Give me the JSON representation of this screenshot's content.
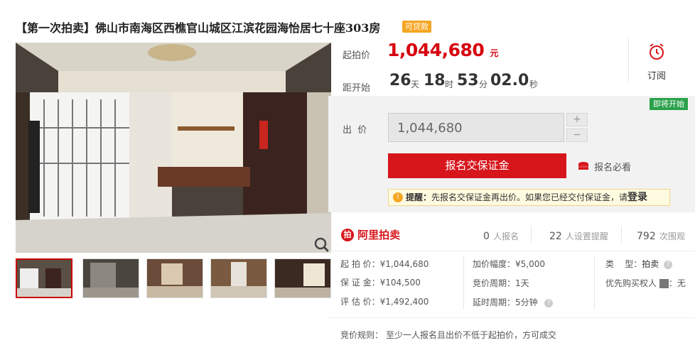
{
  "listing": {
    "title": "【第一次拍卖】佛山市南海区西樵官山城区江滨花园海怡居七十座303房",
    "loan_badge": "可贷款"
  },
  "price": {
    "start_label": "起拍价",
    "start_value": "1,044,680",
    "currency": "元"
  },
  "countdown": {
    "label": "距开始",
    "days": "26",
    "days_unit": "天",
    "hours": "18",
    "hours_unit": "时",
    "minutes": "53",
    "minutes_unit": "分",
    "seconds": "02.0",
    "seconds_unit": "秒"
  },
  "subscribe": {
    "label": "订阅",
    "icon": "alarm-clock-icon"
  },
  "bid": {
    "status_badge": "即将开始",
    "label": "出  价",
    "value": "1,044,680",
    "plus": "+",
    "minus": "−",
    "register_button": "报名交保证金",
    "must_read": "报名必看",
    "tip_prefix": "提醒：",
    "tip_text": "先报名交保证金再出价。如果您已经交付保证金，请",
    "tip_login": "登录"
  },
  "platform": {
    "name": "阿里拍卖",
    "icon": "ali-auction-logo-icon"
  },
  "stats": [
    {
      "value": "0",
      "unit": "人报名"
    },
    {
      "value": "22",
      "unit": "人设置提醒"
    },
    {
      "value": "792",
      "unit": "次围观"
    }
  ],
  "details": {
    "start_price": {
      "label": "起 拍 价：",
      "value": "¥1,044,680"
    },
    "deposit": {
      "label": "保 证 金：",
      "value": "¥104,500"
    },
    "appraisal": {
      "label": "评 估 价：",
      "value": "¥1,492,400"
    },
    "increment": {
      "label": "加价幅度：",
      "value": "¥5,000"
    },
    "bid_cycle": {
      "label": "竞价周期：",
      "value": "1天"
    },
    "delay_cycle": {
      "label": "延时周期：",
      "value": "5分钟"
    },
    "type": {
      "label": "类    型：",
      "value": "拍卖"
    },
    "priority": {
      "label": "优先购买权人",
      "value": "无"
    }
  },
  "rule": {
    "label": "竞价规则：",
    "text": "至少一人报名且出价不低于起拍价，方可成交"
  },
  "colors": {
    "accent": "#d7161c",
    "badge": "#f5a623",
    "green": "#2aa14b"
  }
}
